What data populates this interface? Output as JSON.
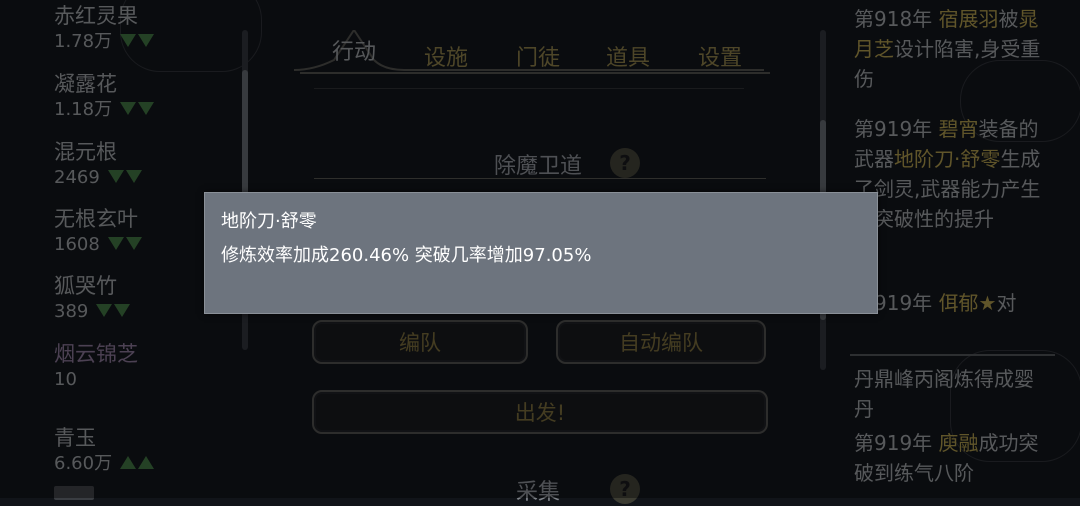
{
  "resources": [
    {
      "name": "赤红灵果",
      "value": "1.78万",
      "trend": "down"
    },
    {
      "name": "凝露花",
      "value": "1.18万",
      "trend": "down"
    },
    {
      "name": "混元根",
      "value": "2469",
      "trend": "down"
    },
    {
      "name": "无根玄叶",
      "value": "1608",
      "trend": "down"
    },
    {
      "name": "狐哭竹",
      "value": "389",
      "trend": "down"
    },
    {
      "name": "烟云锦芝",
      "value": "10",
      "trend": ""
    },
    {
      "name": "青玉",
      "value": "6.60万",
      "trend": "up"
    }
  ],
  "tabs": [
    "行动",
    "设施",
    "门徒",
    "道具",
    "设置"
  ],
  "active_tab": "行动",
  "section_demon": {
    "title": "除魔卫道"
  },
  "buttons": {
    "team": "编队",
    "auto_team": "自动编队",
    "depart": "出发!"
  },
  "section_gather": {
    "title": "采集"
  },
  "help_symbol": "?",
  "log": {
    "e1_prefix": "第918年 ",
    "e1_name": "宿展羽",
    "e1_mid": "被",
    "e1_name2": "晁月芝",
    "e1_text": "设计陷害,身受重伤",
    "e2_prefix": "第919年 ",
    "e2_name": "碧宵",
    "e2_mid": "装备的武器",
    "e2_item": "地阶刀·舒零",
    "e2_text": "生成了剑灵,武器能力产生了突破性的提升",
    "e3_prefix": "第919年 ",
    "e3_name": "佴郁★",
    "e3_text": "对",
    "news1": "丹鼎峰丙阁炼得成婴丹",
    "e4_prefix": "第919年 ",
    "e4_name": "庾融",
    "e4_text": "成功突破到练气八阶"
  },
  "popup": {
    "title": "地阶刀·舒零",
    "desc": "修炼效率加成260.46% 突破几率增加97.05%"
  },
  "colors": {
    "gold": "#7a6a33",
    "popup_bg": "#6d747e",
    "trend_green": "#3a6a3c"
  }
}
